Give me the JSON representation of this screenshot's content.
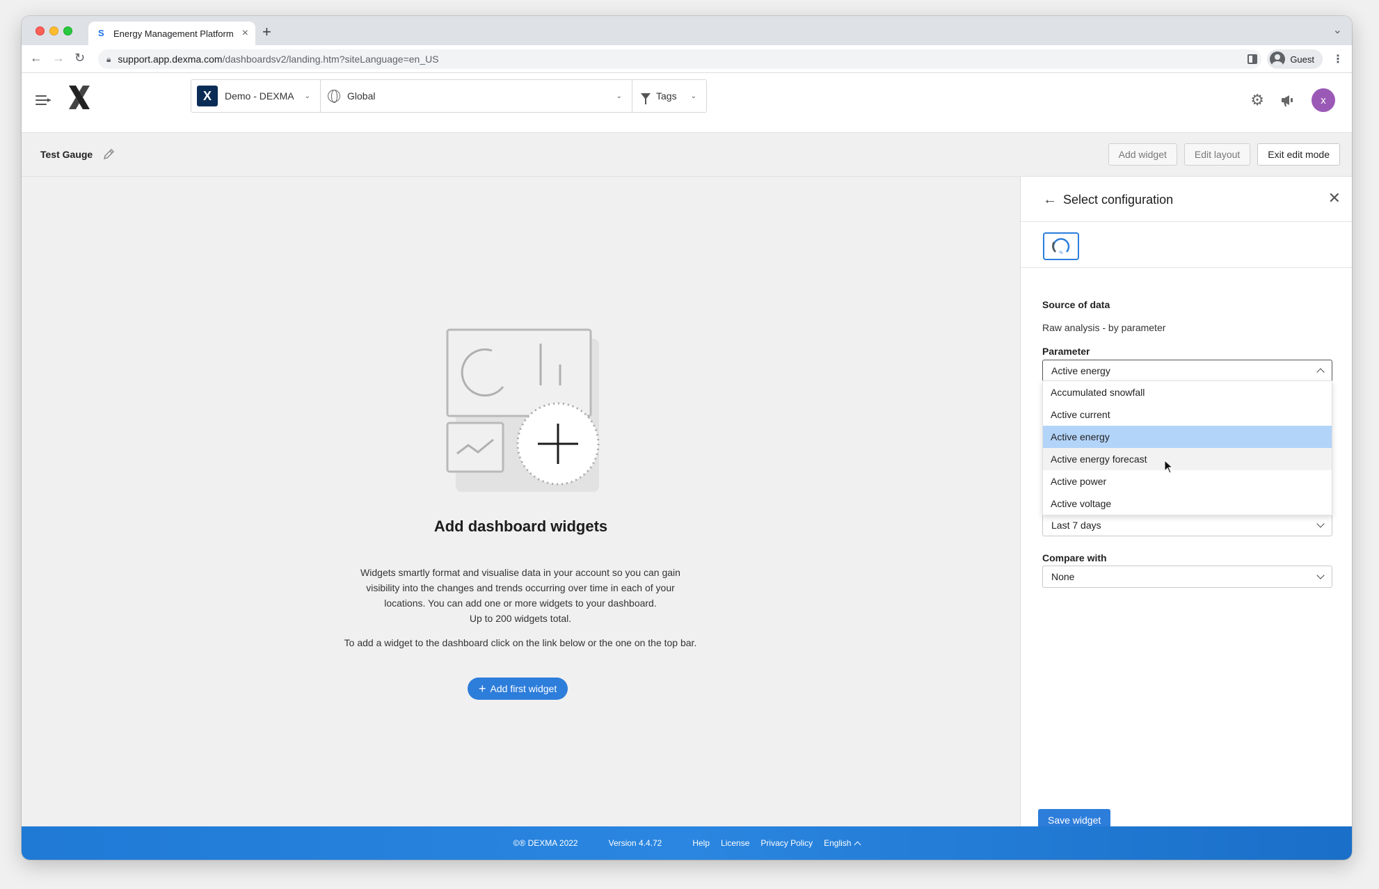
{
  "browser": {
    "tab_title": "Energy Management Platform",
    "url_host": "support.app.dexma.com",
    "url_path": "/dashboardsv2/landing.htm?siteLanguage=en_US",
    "profile_name": "Guest"
  },
  "header": {
    "org_name": "Demo - DEXMA",
    "location": "Global",
    "tags_label": "Tags",
    "user_initial": "x"
  },
  "subheader": {
    "dashboard_title": "Test Gauge",
    "add_widget": "Add widget",
    "edit_layout": "Edit layout",
    "exit_edit_mode": "Exit edit mode"
  },
  "empty_state": {
    "title": "Add dashboard widgets",
    "description": "Widgets smartly format and visualise data in your account so you can gain visibility into the changes and trends occurring over time in each of your locations. You can add one or more widgets to your dashboard.",
    "limit": "Up to 200 widgets total.",
    "instructions": "To add a widget to the dashboard click on the link below or the one on the top bar.",
    "button": "Add first widget"
  },
  "panel": {
    "title": "Select configuration",
    "source_label": "Source of data",
    "source_value": "Raw analysis - by parameter",
    "parameter_label": "Parameter",
    "parameter_value": "Active energy",
    "parameter_options": [
      "Accumulated snowfall",
      "Active current",
      "Active energy",
      "Active energy forecast",
      "Active power",
      "Active voltage"
    ],
    "selected_option_index": 2,
    "hover_option_index": 3,
    "period_value": "Last 7 days",
    "compare_label": "Compare with",
    "compare_value": "None",
    "save_button": "Save widget"
  },
  "footer": {
    "copyright": "©® DEXMA 2022",
    "version": "Version 4.4.72",
    "help": "Help",
    "license": "License",
    "privacy": "Privacy Policy",
    "language": "English"
  },
  "colors": {
    "accent": "#2d7ddb",
    "selected_option": "#b3d4f9",
    "avatar": "#9b59b6",
    "org_badge": "#0b2d55"
  }
}
